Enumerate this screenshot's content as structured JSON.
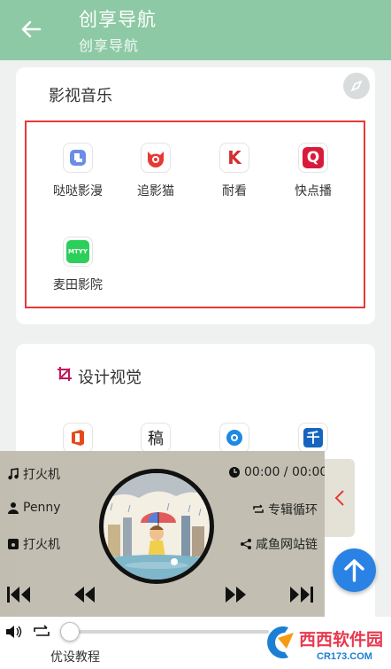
{
  "appbar": {
    "title": "创享导航",
    "subtitle": "创享导航"
  },
  "section1": {
    "title": "影视音乐",
    "apps": [
      {
        "label": "哒哒影漫",
        "icon": "dada-icon",
        "color": "#3f6fe0"
      },
      {
        "label": "追影猫",
        "icon": "cat-icon",
        "color": "#e53935"
      },
      {
        "label": "耐看",
        "icon": "naikan-icon",
        "glyph": "K",
        "color": "#d32f2f"
      },
      {
        "label": "快点播",
        "icon": "kuaidianbo-icon",
        "glyph": "Q",
        "color": "#d81b3a"
      },
      {
        "label": "麦田影院",
        "icon": "maitian-icon",
        "glyph": "MTYY",
        "color": "#2bd05b"
      }
    ]
  },
  "section2": {
    "title": "设计视觉",
    "apps": [
      {
        "icon": "office-icon",
        "color": "#e64a19"
      },
      {
        "icon": "gao-icon",
        "glyph": "稿",
        "color": "#222222"
      },
      {
        "icon": "camera-icon",
        "color": "#1e88e5"
      },
      {
        "icon": "qian-icon",
        "glyph": "千",
        "color": "#1565c0"
      }
    ],
    "footer_label": "优设教程"
  },
  "player": {
    "song": "打火机",
    "artist": "Penny",
    "album": "打火机",
    "time": "00:00 / 00:00",
    "mode": "专辑循环",
    "share": "咸鱼网站链"
  },
  "watermark": {
    "brand": "西西软件园",
    "domain": "CR173.COM"
  }
}
